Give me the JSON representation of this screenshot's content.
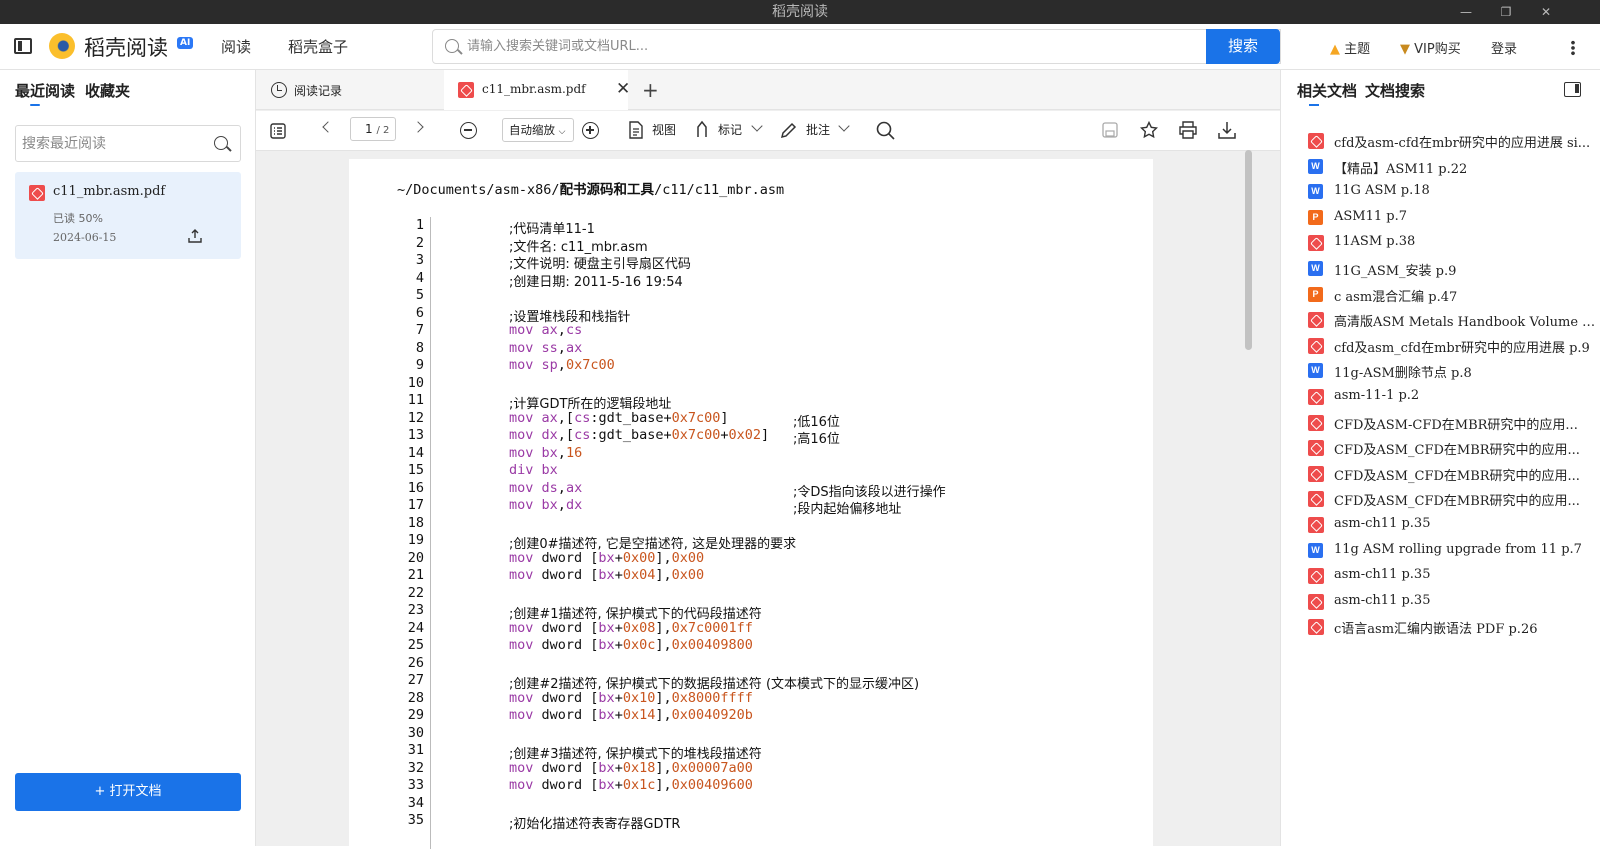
{
  "window": {
    "title": "稻壳阅读"
  },
  "header": {
    "app_name": "稻壳阅读",
    "ai_badge": "AI",
    "nav": [
      "阅读",
      "稻壳盒子"
    ],
    "search_placeholder": "请输入搜索关键词或文档URL...",
    "search_button": "搜索",
    "theme": "主题",
    "vip": "VIP购买",
    "login": "登录"
  },
  "left": {
    "tabs": [
      "最近阅读",
      "收藏夹"
    ],
    "search_placeholder": "搜索最近阅读",
    "recent": {
      "name": "c11_mbr.asm.pdf",
      "progress": "已读 50%",
      "date": "2024-06-15"
    },
    "open_button": "+ 打开文档"
  },
  "tabs": {
    "history": "阅读记录",
    "active": "c11_mbr.asm.pdf"
  },
  "toolbar": {
    "page_current": "1",
    "page_total": "/ 2",
    "zoom": "自动缩放",
    "view": "视图",
    "mark": "标记",
    "annotate": "批注"
  },
  "doc": {
    "path_prefix": "~/Documents/asm-x86/",
    "path_bold": "配书源码和工具",
    "path_suffix": "/c11/c11_mbr.asm",
    "lines": [
      {
        "n": "1",
        "code": "",
        "comment": ";代码清单11-1"
      },
      {
        "n": "2",
        "code": "",
        "comment": ";文件名: c11_mbr.asm"
      },
      {
        "n": "3",
        "code": "",
        "comment": ";文件说明: 硬盘主引导扇区代码"
      },
      {
        "n": "4",
        "code": "",
        "comment": ";创建日期: 2011-5-16 19:54"
      },
      {
        "n": "5",
        "code": "",
        "comment": ""
      },
      {
        "n": "6",
        "code": "",
        "comment": ";设置堆栈段和栈指针"
      },
      {
        "n": "7",
        "code": "mov ax,cs",
        "comment": ""
      },
      {
        "n": "8",
        "code": "mov ss,ax",
        "comment": ""
      },
      {
        "n": "9",
        "code": "mov sp,0x7c00",
        "comment": ""
      },
      {
        "n": "10",
        "code": "",
        "comment": ""
      },
      {
        "n": "11",
        "code": "",
        "comment": ";计算GDT所在的逻辑段地址"
      },
      {
        "n": "12",
        "code": "mov ax,[cs:gdt_base+0x7c00]",
        "comment": ";低16位"
      },
      {
        "n": "13",
        "code": "mov dx,[cs:gdt_base+0x7c00+0x02]",
        "comment": ";高16位"
      },
      {
        "n": "14",
        "code": "mov bx,16",
        "comment": ""
      },
      {
        "n": "15",
        "code": "div bx",
        "comment": ""
      },
      {
        "n": "16",
        "code": "mov ds,ax",
        "comment": ";令DS指向该段以进行操作"
      },
      {
        "n": "17",
        "code": "mov bx,dx",
        "comment": ";段内起始偏移地址"
      },
      {
        "n": "18",
        "code": "",
        "comment": ""
      },
      {
        "n": "19",
        "code": "",
        "comment": ";创建0#描述符, 它是空描述符, 这是处理器的要求"
      },
      {
        "n": "20",
        "code": "mov dword [bx+0x00],0x00",
        "comment": ""
      },
      {
        "n": "21",
        "code": "mov dword [bx+0x04],0x00",
        "comment": ""
      },
      {
        "n": "22",
        "code": "",
        "comment": ""
      },
      {
        "n": "23",
        "code": "",
        "comment": ";创建#1描述符, 保护模式下的代码段描述符"
      },
      {
        "n": "24",
        "code": "mov dword [bx+0x08],0x7c0001ff",
        "comment": ""
      },
      {
        "n": "25",
        "code": "mov dword [bx+0x0c],0x00409800",
        "comment": ""
      },
      {
        "n": "26",
        "code": "",
        "comment": ""
      },
      {
        "n": "27",
        "code": "",
        "comment": ";创建#2描述符, 保护模式下的数据段描述符 (文本模式下的显示缓冲区)"
      },
      {
        "n": "28",
        "code": "mov dword [bx+0x10],0x8000ffff",
        "comment": ""
      },
      {
        "n": "29",
        "code": "mov dword [bx+0x14],0x0040920b",
        "comment": ""
      },
      {
        "n": "30",
        "code": "",
        "comment": ""
      },
      {
        "n": "31",
        "code": "",
        "comment": ";创建#3描述符, 保护模式下的堆栈段描述符"
      },
      {
        "n": "32",
        "code": "mov dword [bx+0x18],0x00007a00",
        "comment": ""
      },
      {
        "n": "33",
        "code": "mov dword [bx+0x1c],0x00409600",
        "comment": ""
      },
      {
        "n": "34",
        "code": "",
        "comment": ""
      },
      {
        "n": "35",
        "code": "",
        "comment": ";初始化描述符表寄存器GDTR"
      }
    ]
  },
  "right": {
    "tabs": [
      "相关文档",
      "文档搜索"
    ],
    "related": [
      {
        "type": "pdf",
        "title": "cfd及asm-cfd在mbr研究中的应用进展 si..."
      },
      {
        "type": "word",
        "title": "【精品】ASM11 p.22"
      },
      {
        "type": "word",
        "title": "11G ASM p.18"
      },
      {
        "type": "ppt",
        "title": "ASM11 p.7"
      },
      {
        "type": "pdf",
        "title": "11ASM p.38"
      },
      {
        "type": "word",
        "title": "11G_ASM_安装 p.9"
      },
      {
        "type": "ppt",
        "title": "c asm混合汇编 p.47"
      },
      {
        "type": "pdf",
        "title": "高清版ASM Metals Handbook Volume 11..."
      },
      {
        "type": "pdf",
        "title": "cfd及asm_cfd在mbr研究中的应用进展 p.9"
      },
      {
        "type": "word",
        "title": "11g-ASM删除节点 p.8"
      },
      {
        "type": "pdf",
        "title": "asm-11-1 p.2"
      },
      {
        "type": "pdf",
        "title": "CFD及ASM-CFD在MBR研究中的应用..."
      },
      {
        "type": "pdf",
        "title": "CFD及ASM_CFD在MBR研究中的应用..."
      },
      {
        "type": "pdf",
        "title": "CFD及ASM_CFD在MBR研究中的应用..."
      },
      {
        "type": "pdf",
        "title": "CFD及ASM_CFD在MBR研究中的应用..."
      },
      {
        "type": "pdf",
        "title": "asm-ch11 p.35"
      },
      {
        "type": "word",
        "title": "11g ASM rolling upgrade from 11 p.7"
      },
      {
        "type": "pdf",
        "title": "asm-ch11 p.35"
      },
      {
        "type": "pdf",
        "title": "asm-ch11 p.35"
      },
      {
        "type": "pdf",
        "title": "c语言asm汇编内嵌语法 PDF p.26"
      }
    ]
  }
}
